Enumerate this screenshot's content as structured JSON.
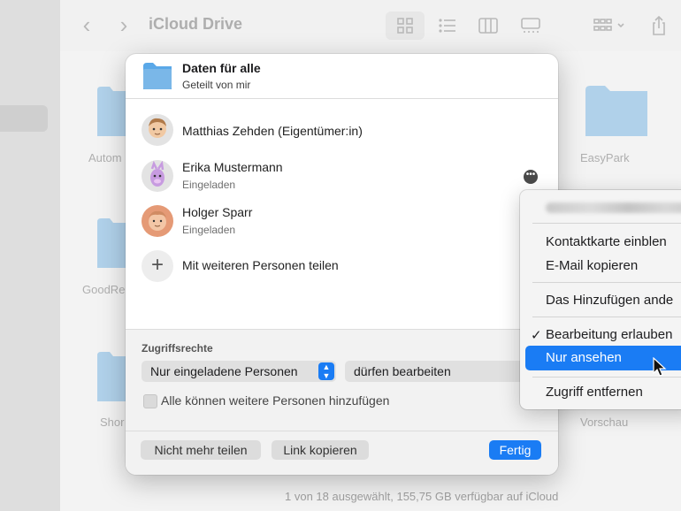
{
  "finder": {
    "title": "iCloud Drive",
    "status": "1 von 18 ausgewählt, 155,75 GB verfügbar auf iCloud",
    "items": [
      "Autom",
      "GoodRe",
      "Shor",
      "EasyPark",
      "Vorschau"
    ]
  },
  "share": {
    "folder_name": "Daten für alle",
    "folder_subtitle": "Geteilt von mir",
    "people": [
      {
        "name": "Matthias Zehden (Eigentümer:in)",
        "status": ""
      },
      {
        "name": "Erika Mustermann",
        "status": "Eingeladen"
      },
      {
        "name": "Holger Sparr",
        "status": "Eingeladen"
      }
    ],
    "add_label": "Mit weiteren Personen teilen",
    "access_label": "Zugriffsrechte",
    "access_who": "Nur eingeladene Personen",
    "access_permission": "dürfen bearbeiten",
    "checkbox_label": "Alle können weitere Personen hinzufügen",
    "stop_sharing": "Nicht mehr teilen",
    "copy_link": "Link kopieren",
    "done": "Fertig"
  },
  "context_menu": {
    "items": [
      {
        "label": "Kontaktkarte einblen",
        "checked": false
      },
      {
        "label": "E-Mail kopieren",
        "checked": false
      },
      {
        "label": "Das Hinzufügen ande",
        "checked": false
      },
      {
        "label": "Bearbeitung erlauben",
        "checked": true
      },
      {
        "label": "Nur ansehen",
        "highlighted": true
      },
      {
        "label": "Zugriff entfernen",
        "checked": false
      }
    ],
    "checkmark": "✓"
  },
  "colors": {
    "accent": "#1a7cf4",
    "folder": "#7ab7e8"
  }
}
